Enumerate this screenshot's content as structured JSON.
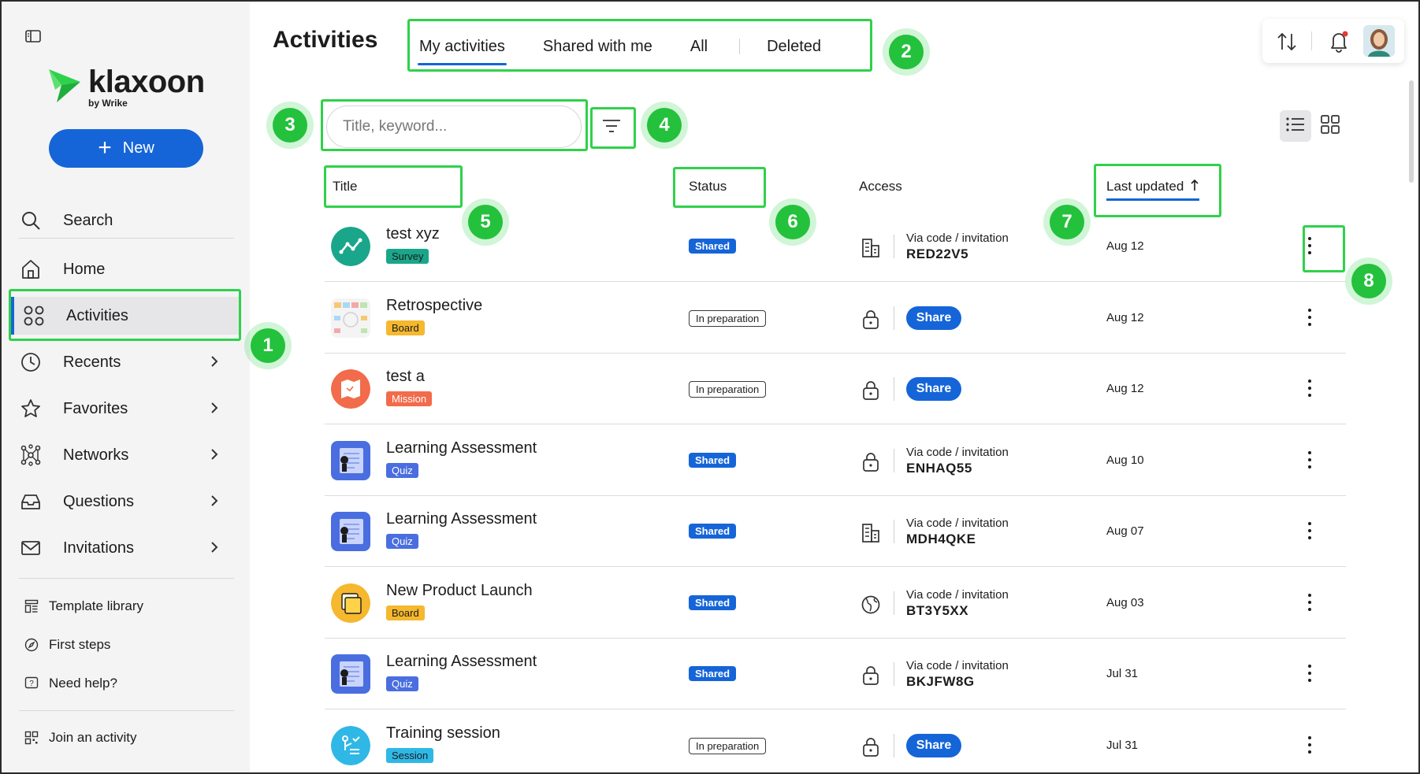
{
  "sidebar": {
    "logo_word": "klaxoon",
    "logo_sub": "by Wrike",
    "new_label": "New",
    "search_label": "Search",
    "nav": [
      {
        "label": "Home",
        "icon": "home-icon"
      },
      {
        "label": "Activities",
        "icon": "activities-icon",
        "active": true
      },
      {
        "label": "Recents",
        "icon": "clock-icon"
      },
      {
        "label": "Favorites",
        "icon": "star-icon"
      },
      {
        "label": "Networks",
        "icon": "network-icon"
      },
      {
        "label": "Questions",
        "icon": "inbox-icon"
      },
      {
        "label": "Invitations",
        "icon": "mail-icon"
      }
    ],
    "footer": [
      {
        "label": "Template library",
        "icon": "template-icon"
      },
      {
        "label": "First steps",
        "icon": "compass-icon"
      },
      {
        "label": "Need help?",
        "icon": "help-icon"
      }
    ],
    "join_label": "Join an activity"
  },
  "header": {
    "title": "Activities",
    "tabs": [
      "My activities",
      "Shared with me",
      "All",
      "Deleted"
    ]
  },
  "search": {
    "placeholder": "Title, keyword..."
  },
  "table": {
    "columns": [
      "Title",
      "Status",
      "Access",
      "Last updated"
    ],
    "rows": [
      {
        "title": "test xyz",
        "type": "Survey",
        "type_color": "#1aa68a",
        "status": "Shared",
        "access": "building",
        "via": "Via code / invitation",
        "code": "RED22V5",
        "date": "Aug 12"
      },
      {
        "title": "Retrospective",
        "type": "Board",
        "type_color": "#f5b82e",
        "status": "In preparation",
        "access": "lock",
        "share": "Share",
        "date": "Aug 12"
      },
      {
        "title": "test a",
        "type": "Mission",
        "type_color": "#f26b4a",
        "status": "In preparation",
        "access": "lock",
        "share": "Share",
        "date": "Aug 12"
      },
      {
        "title": "Learning Assessment",
        "type": "Quiz",
        "type_color": "#4a6ee0",
        "status": "Shared",
        "access": "lock",
        "via": "Via code / invitation",
        "code": "ENHAQ55",
        "date": "Aug 10"
      },
      {
        "title": "Learning Assessment",
        "type": "Quiz",
        "type_color": "#4a6ee0",
        "status": "Shared",
        "access": "building",
        "via": "Via code / invitation",
        "code": "MDH4QKE",
        "date": "Aug 07"
      },
      {
        "title": "New Product Launch",
        "type": "Board",
        "type_color": "#f5b82e",
        "status": "Shared",
        "access": "globe",
        "via": "Via code / invitation",
        "code": "BT3Y5XX",
        "date": "Aug 03"
      },
      {
        "title": "Learning Assessment",
        "type": "Quiz",
        "type_color": "#4a6ee0",
        "status": "Shared",
        "access": "lock",
        "via": "Via code / invitation",
        "code": "BKJFW8G",
        "date": "Jul 31"
      },
      {
        "title": "Training session",
        "type": "Session",
        "type_color": "#2fb8e6",
        "status": "In preparation",
        "access": "lock",
        "share": "Share",
        "date": "Jul 31"
      }
    ]
  },
  "annotations": [
    "1",
    "2",
    "3",
    "4",
    "5",
    "6",
    "7",
    "8"
  ],
  "colors": {
    "accent": "#1565d8",
    "highlight": "#2fd14a"
  }
}
